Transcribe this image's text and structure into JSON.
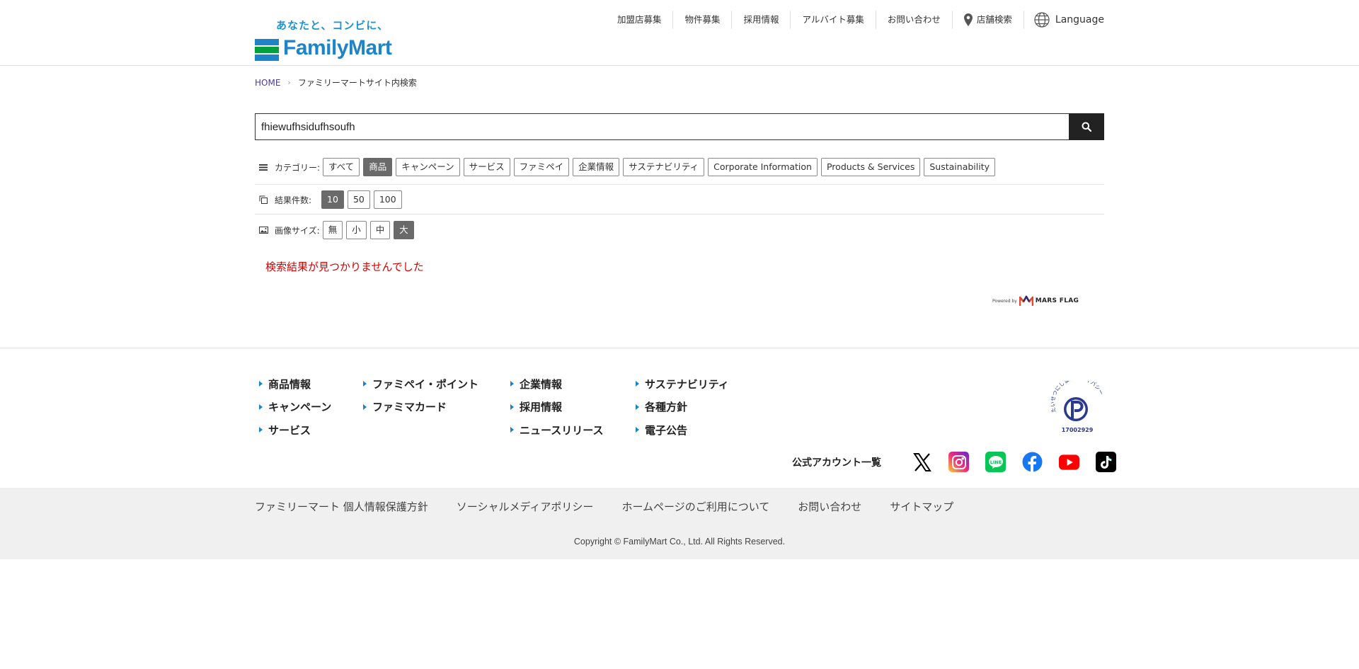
{
  "header": {
    "tagline": "あなたと、コンビに、",
    "logo_text": "FamilyMart",
    "logo_colors": {
      "green": "#00a040",
      "blue": "#1e84c8"
    },
    "nav": [
      {
        "label": "加盟店募集"
      },
      {
        "label": "物件募集"
      },
      {
        "label": "採用情報"
      },
      {
        "label": "アルバイト募集"
      },
      {
        "label": "お問い合わせ"
      }
    ],
    "store_search": {
      "label": "店舗検索",
      "icon": "map-pin-icon"
    },
    "language": {
      "label": "Language",
      "icon": "globe-icon"
    }
  },
  "breadcrumb": {
    "home": "HOME",
    "current": "ファミリーマートサイト内検索"
  },
  "search": {
    "query": "fhiewufhsidufhsoufh",
    "button_icon": "search-icon"
  },
  "filters": {
    "category": {
      "label": "カテゴリー:",
      "icon": "list-icon",
      "options": [
        "すべて",
        "商品",
        "キャンペーン",
        "サービス",
        "ファミペイ",
        "企業情報",
        "サステナビリティ",
        "Corporate Information",
        "Products & Services",
        "Sustainability"
      ],
      "selected": "商品"
    },
    "result_count": {
      "label": "結果件数:",
      "icon": "copy-icon",
      "options": [
        "10",
        "50",
        "100"
      ],
      "selected": "10"
    },
    "image_size": {
      "label": "画像サイズ:",
      "icon": "image-icon",
      "options": [
        "無",
        "小",
        "中",
        "大"
      ],
      "selected": "大"
    }
  },
  "no_result": "検索結果が見つかりませんでした",
  "powered_by": {
    "prefix": "Powered by",
    "brand": "MARS FLAG"
  },
  "footer": {
    "columns": [
      [
        "商品情報",
        "キャンペーン",
        "サービス"
      ],
      [
        "ファミペイ・ポイント",
        "ファミマカード"
      ],
      [
        "企業情報",
        "採用情報",
        "ニュースリリース"
      ],
      [
        "サステナビリティ",
        "各種方針",
        "電子公告"
      ]
    ],
    "privacy_mark": {
      "text": "たいせつにしますプライバシー",
      "number": "17002929"
    },
    "social": {
      "title": "公式アカウント一覧",
      "accounts": [
        {
          "name": "x-icon",
          "color": "#000000"
        },
        {
          "name": "instagram-icon",
          "color": "#d6249f"
        },
        {
          "name": "line-icon",
          "color": "#06c755"
        },
        {
          "name": "facebook-icon",
          "color": "#1877f2"
        },
        {
          "name": "youtube-icon",
          "color": "#ff0000"
        },
        {
          "name": "tiktok-icon",
          "color": "#000000"
        }
      ]
    },
    "links": [
      "ファミリーマート 個人情報保護方針",
      "ソーシャルメディアポリシー",
      "ホームページのご利用について",
      "お問い合わせ",
      "サイトマップ"
    ],
    "copyright": "Copyright © FamilyMart Co., Ltd. All Rights Reserved."
  }
}
